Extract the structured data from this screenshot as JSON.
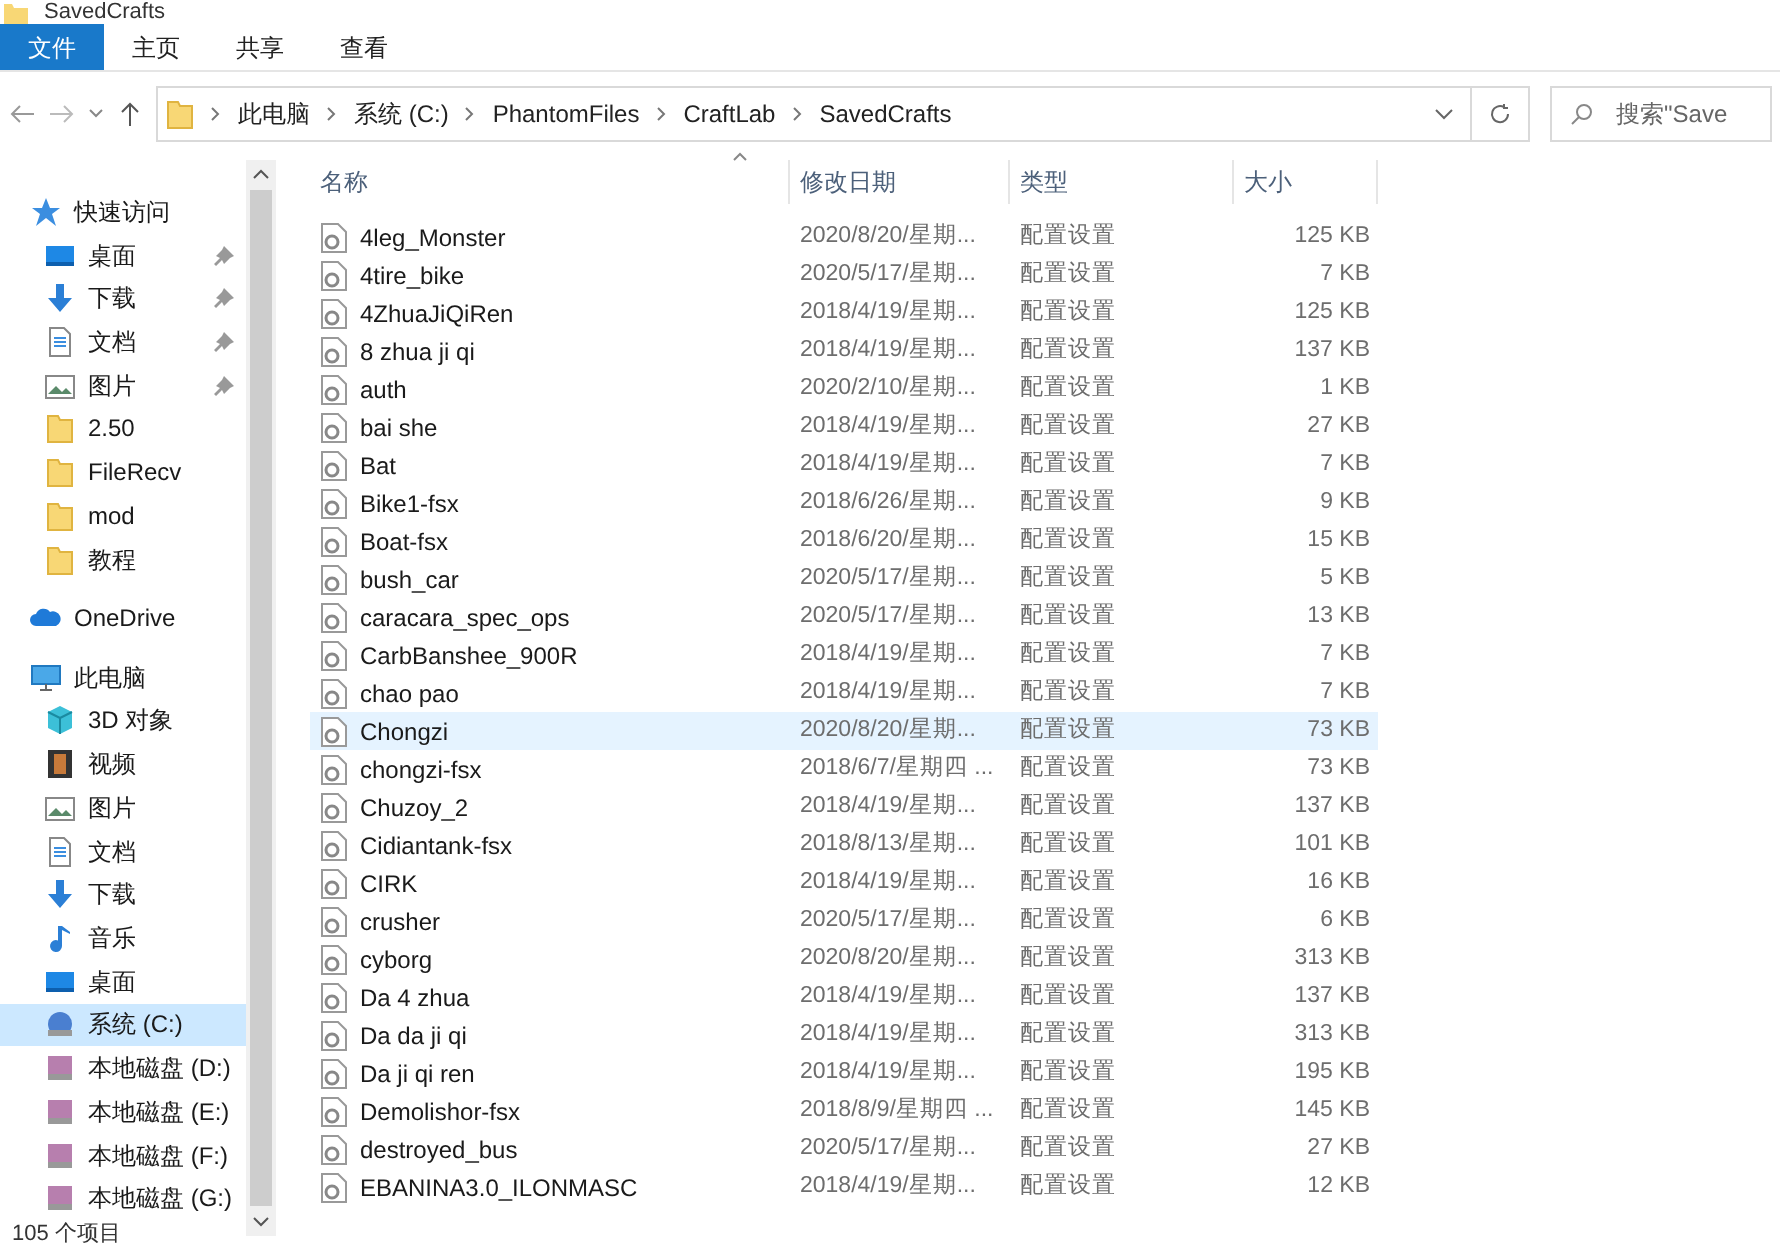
{
  "window": {
    "title": "SavedCrafts"
  },
  "ribbon_tabs": [
    {
      "label": "文件",
      "selected": true
    },
    {
      "label": "主页",
      "selected": false
    },
    {
      "label": "共享",
      "selected": false
    },
    {
      "label": "查看",
      "selected": false
    }
  ],
  "address_bar": {
    "path": [
      "此电脑",
      "系统 (C:)",
      "PhantomFiles",
      "CraftLab",
      "SavedCrafts"
    ]
  },
  "search": {
    "placeholder": "搜索\"Save"
  },
  "sidebar": {
    "items": [
      {
        "label": "快速访问",
        "kind": "star",
        "selected": false,
        "children": [
          {
            "label": "桌面",
            "kind": "desktop",
            "pinned": true,
            "selected": false
          },
          {
            "label": "下载",
            "kind": "download",
            "pinned": true,
            "selected": false
          },
          {
            "label": "文档",
            "kind": "document",
            "pinned": true,
            "selected": false
          },
          {
            "label": "图片",
            "kind": "picture",
            "pinned": true,
            "selected": false
          },
          {
            "label": "2.50",
            "kind": "folder",
            "pinned": false,
            "selected": false
          },
          {
            "label": "FileRecv",
            "kind": "folder",
            "pinned": false,
            "selected": false
          },
          {
            "label": "mod",
            "kind": "folder",
            "pinned": false,
            "selected": false
          },
          {
            "label": "教程",
            "kind": "folder",
            "pinned": false,
            "selected": false
          }
        ]
      },
      {
        "label": "OneDrive",
        "kind": "cloud",
        "selected": false
      },
      {
        "label": "此电脑",
        "kind": "computer",
        "selected": false,
        "children": [
          {
            "label": "3D 对象",
            "kind": "cube",
            "pinned": false,
            "selected": false
          },
          {
            "label": "视频",
            "kind": "film",
            "pinned": false,
            "selected": false
          },
          {
            "label": "图片",
            "kind": "picture",
            "pinned": false,
            "selected": false
          },
          {
            "label": "文档",
            "kind": "document",
            "pinned": false,
            "selected": false
          },
          {
            "label": "下载",
            "kind": "download",
            "pinned": false,
            "selected": false
          },
          {
            "label": "音乐",
            "kind": "music",
            "pinned": false,
            "selected": false
          },
          {
            "label": "桌面",
            "kind": "desktop",
            "pinned": false,
            "selected": false
          },
          {
            "label": "系统 (C:)",
            "kind": "systemdrive",
            "pinned": false,
            "selected": true
          },
          {
            "label": "本地磁盘 (D:)",
            "kind": "drive",
            "pinned": false,
            "selected": false
          },
          {
            "label": "本地磁盘 (E:)",
            "kind": "drive",
            "pinned": false,
            "selected": false
          },
          {
            "label": "本地磁盘 (F:)",
            "kind": "drive",
            "pinned": false,
            "selected": false
          },
          {
            "label": "本地磁盘 (G:)",
            "kind": "drive",
            "pinned": false,
            "selected": false
          }
        ]
      }
    ]
  },
  "table": {
    "columns": [
      "名称",
      "修改日期",
      "类型",
      "大小"
    ],
    "rows": [
      {
        "name": "4leg_Monster",
        "date": "2020/8/20/星期...",
        "type": "配置设置",
        "size": "125 KB",
        "selected": false
      },
      {
        "name": "4tire_bike",
        "date": "2020/5/17/星期...",
        "type": "配置设置",
        "size": "7 KB",
        "selected": false
      },
      {
        "name": "4ZhuaJiQiRen",
        "date": "2018/4/19/星期...",
        "type": "配置设置",
        "size": "125 KB",
        "selected": false
      },
      {
        "name": "8 zhua ji qi",
        "date": "2018/4/19/星期...",
        "type": "配置设置",
        "size": "137 KB",
        "selected": false
      },
      {
        "name": "auth",
        "date": "2020/2/10/星期...",
        "type": "配置设置",
        "size": "1 KB",
        "selected": false
      },
      {
        "name": "bai she",
        "date": "2018/4/19/星期...",
        "type": "配置设置",
        "size": "27 KB",
        "selected": false
      },
      {
        "name": "Bat",
        "date": "2018/4/19/星期...",
        "type": "配置设置",
        "size": "7 KB",
        "selected": false
      },
      {
        "name": "Bike1-fsx",
        "date": "2018/6/26/星期...",
        "type": "配置设置",
        "size": "9 KB",
        "selected": false
      },
      {
        "name": "Boat-fsx",
        "date": "2018/6/20/星期...",
        "type": "配置设置",
        "size": "15 KB",
        "selected": false
      },
      {
        "name": "bush_car",
        "date": "2020/5/17/星期...",
        "type": "配置设置",
        "size": "5 KB",
        "selected": false
      },
      {
        "name": "caracara_spec_ops",
        "date": "2020/5/17/星期...",
        "type": "配置设置",
        "size": "13 KB",
        "selected": false
      },
      {
        "name": "CarbBanshee_900R",
        "date": "2018/4/19/星期...",
        "type": "配置设置",
        "size": "7 KB",
        "selected": false
      },
      {
        "name": "chao pao",
        "date": "2018/4/19/星期...",
        "type": "配置设置",
        "size": "7 KB",
        "selected": false
      },
      {
        "name": "Chongzi",
        "date": "2020/8/20/星期...",
        "type": "配置设置",
        "size": "73 KB",
        "selected": true
      },
      {
        "name": "chongzi-fsx",
        "date": "2018/6/7/星期四 ...",
        "type": "配置设置",
        "size": "73 KB",
        "selected": false
      },
      {
        "name": "Chuzoy_2",
        "date": "2018/4/19/星期...",
        "type": "配置设置",
        "size": "137 KB",
        "selected": false
      },
      {
        "name": "Cidiantank-fsx",
        "date": "2018/8/13/星期...",
        "type": "配置设置",
        "size": "101 KB",
        "selected": false
      },
      {
        "name": "CIRK",
        "date": "2018/4/19/星期...",
        "type": "配置设置",
        "size": "16 KB",
        "selected": false
      },
      {
        "name": "crusher",
        "date": "2020/5/17/星期...",
        "type": "配置设置",
        "size": "6 KB",
        "selected": false
      },
      {
        "name": "cyborg",
        "date": "2020/8/20/星期...",
        "type": "配置设置",
        "size": "313 KB",
        "selected": false
      },
      {
        "name": "Da 4 zhua",
        "date": "2018/4/19/星期...",
        "type": "配置设置",
        "size": "137 KB",
        "selected": false
      },
      {
        "name": "Da da ji qi",
        "date": "2018/4/19/星期...",
        "type": "配置设置",
        "size": "313 KB",
        "selected": false
      },
      {
        "name": "Da ji qi ren",
        "date": "2018/4/19/星期...",
        "type": "配置设置",
        "size": "195 KB",
        "selected": false
      },
      {
        "name": "Demolishor-fsx",
        "date": "2018/8/9/星期四 ...",
        "type": "配置设置",
        "size": "145 KB",
        "selected": false
      },
      {
        "name": "destroyed_bus",
        "date": "2020/5/17/星期...",
        "type": "配置设置",
        "size": "27 KB",
        "selected": false
      },
      {
        "name": "EBANINA3.0_ILONMASC",
        "date": "2018/4/19/星期...",
        "type": "配置设置",
        "size": "12 KB",
        "selected": false
      }
    ]
  },
  "status_bar": {
    "text": "105 个项目"
  }
}
